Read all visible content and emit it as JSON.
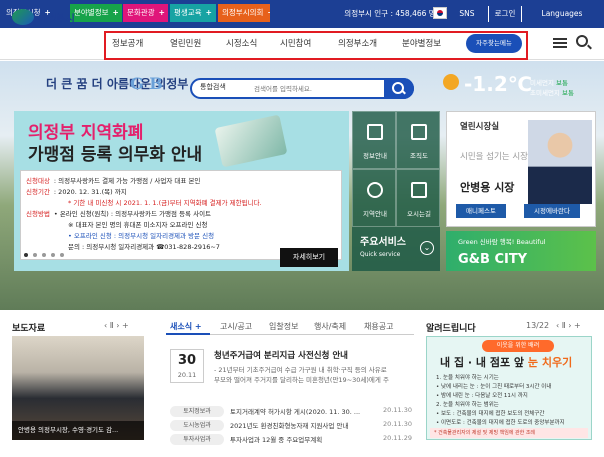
{
  "top_tabs": [
    {
      "label": "의정부시청",
      "color": "#1c3f94"
    },
    {
      "label": "분야별정보",
      "color": "#17a34a"
    },
    {
      "label": "문화관광",
      "color": "#e0157a"
    },
    {
      "label": "평생교육",
      "color": "#17a3a3"
    },
    {
      "label": "의정부시의회",
      "color": "#e7611b"
    }
  ],
  "population": "의정부시 인구 : 458,466 명",
  "top_buttons": {
    "sns": "SNS",
    "login": "로그인",
    "languages": "Languages"
  },
  "logo": {
    "text": "의정부시"
  },
  "gnb": {
    "items": [
      "정보공개",
      "열린민원",
      "시정소식",
      "시민참여",
      "의정부소개",
      "분야별정보"
    ],
    "favorites": "자주찾는메뉴"
  },
  "hero": {
    "slogan": "더 큰 꿈 더 아름다운 의정부",
    "brand": "G B",
    "search": {
      "select": "통합검색",
      "placeholder": "검색어를 입력하세요."
    },
    "weather": {
      "temp": "-1.2℃",
      "dust1_label": "미세먼지",
      "dust1_value": "보통",
      "dust2_label": "초미세먼지",
      "dust2_value": "보통"
    }
  },
  "banner": {
    "title1": "의정부 지역화폐",
    "title2": "가맹점 등록 의무화 안내",
    "lines": [
      {
        "label": "신청대상",
        "text": ": 의정부사랑카드 결제 가능 가맹점 / 사업자 대표 본인"
      },
      {
        "label": "신청기간",
        "text": ": 2020. 12. 31.(목) 까지"
      },
      {
        "label": "",
        "text": "* 기한 내 미신청 시 2021. 1. 1.(금)부터 지역화폐 결제가 제한됩니다."
      },
      {
        "label": "신청방법",
        "text": "• 온라인 신청(원칙) : 의정부사랑카드 가맹점 등록 사이트"
      },
      {
        "label": "",
        "text": "※ 대표자 본인 명의 휴대폰 미소지자 오프라인 신청"
      },
      {
        "label": "",
        "text": "• 오프라인 신청 : 의정부시청 일자리경제과 방문 신청"
      },
      {
        "label": "",
        "text": "문의 : 의정부시청 일자리경제과 ☎031-828-2916~7"
      }
    ],
    "detail": "자세히보기"
  },
  "tiles": [
    "정보안내",
    "조직도",
    "지역안내",
    "오시는길"
  ],
  "quick": {
    "title": "주요서비스",
    "sub": "Quick service"
  },
  "mayor": {
    "heading": "열린시장실",
    "slogan": "시민을 섬기는 시장",
    "name": "안병용 시장",
    "btn1": "매니페스토",
    "btn2": "시정에바란다"
  },
  "gb_city": {
    "sub": "Green 신바람 행복! Beautiful",
    "title": "G&B CITY"
  },
  "press": {
    "title": "보도자료",
    "caption": "안병용 의정부시장, 수영·경기도 감..."
  },
  "news": {
    "tabs": [
      "새소식",
      "고시/공고",
      "입찰정보",
      "행사/축제",
      "채용공고"
    ],
    "featured": {
      "day": "30",
      "ym": "20.11",
      "title": "청년주거급여 분리지급 사전신청 안내",
      "desc1": "- 21년부터 기초주거급여 수급 가구원 내 취학·구직 등의 사유로",
      "desc2": "부모와 떨어져 주거지를 달리하는 미혼청년(만19~30세)에게 주"
    },
    "items": [
      {
        "tag": "토지정보과",
        "title": "토지거래계약 허가시항 게시(2020. 11. 30. ...",
        "date": "20.11.30"
      },
      {
        "tag": "도시농업과",
        "title": "2021년도 환경친화형농자재 지원사업 안내",
        "date": "20.11.30"
      },
      {
        "tag": "투자사업과",
        "title": "투자사업과 12월 중 주요업무계획",
        "date": "20.11.29"
      }
    ]
  },
  "alerts": {
    "title": "알려드립니다",
    "page": "13/22",
    "ribbon": "이웃을 위한 배려",
    "head1": "내 집 · 내 점포 앞",
    "head2": "눈 치우기",
    "lines": [
      "1. 눈을 치워야 하는 시기는",
      "   • 낮에 내리는 눈 : 눈이 그친 때로부터 3시간 이내",
      "   • 밤에 내린 눈 : 다음날 오전 11시 까지",
      "2. 눈을 치워야 하는 범위는",
      "   • 보도 : 건축물의 대지에 접한 보도의 전체구간",
      "   • 이면도로 : 건축물의 대지에 접한 도로의 중앙부분까지"
    ],
    "foot": "* 건축물관리자의 제설 및 제빙 책임에 관한 조례"
  }
}
